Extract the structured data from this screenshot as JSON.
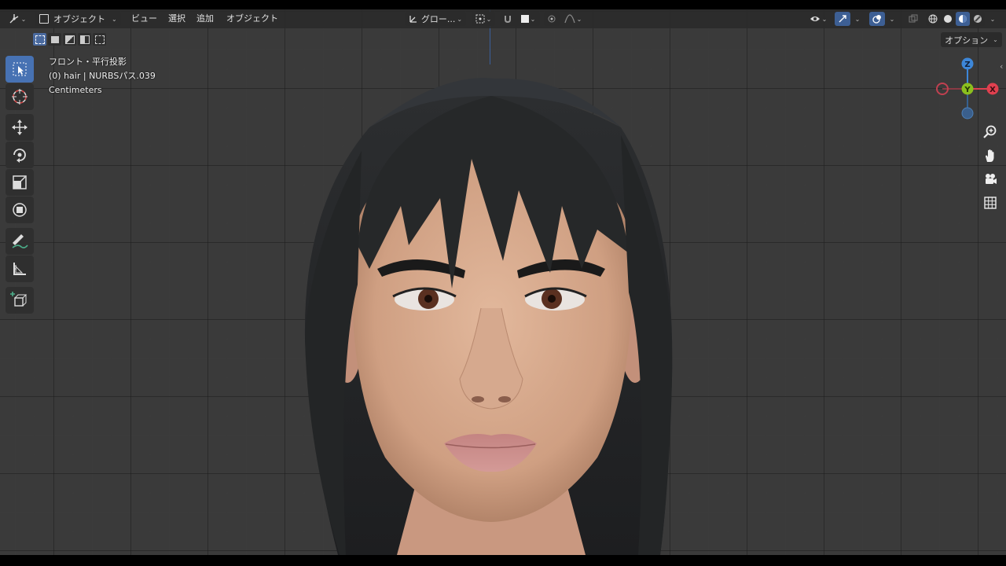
{
  "header": {
    "editor_type_icon": "3d-viewport-icon",
    "mode_label": "オブジェクト",
    "menus": [
      "ビュー",
      "選択",
      "追加",
      "オブジェクト"
    ],
    "transform_orientation": "グロー...",
    "shading_modes": [
      "wireframe",
      "solid",
      "material-preview",
      "rendered"
    ]
  },
  "options_label": "オプション",
  "overlay_info": {
    "view_name": "フロント・平行投影",
    "object_info": "(0) hair | NURBSパス.039",
    "units": "Centimeters"
  },
  "gizmo": {
    "z_label": "Z",
    "y_label": "Y",
    "x_label": "X",
    "colors": {
      "x": "#e0404f",
      "y": "#8bbf1e",
      "z": "#3d87d9"
    }
  },
  "tools": [
    "select-box",
    "cursor",
    "move",
    "rotate",
    "scale",
    "transform",
    "annotate",
    "measure",
    "add-cube"
  ],
  "nav_buttons": [
    "zoom",
    "pan",
    "camera",
    "toggle-ortho"
  ],
  "colors": {
    "accent": "#4772b3",
    "viewport_bg": "#3a3a3a"
  }
}
